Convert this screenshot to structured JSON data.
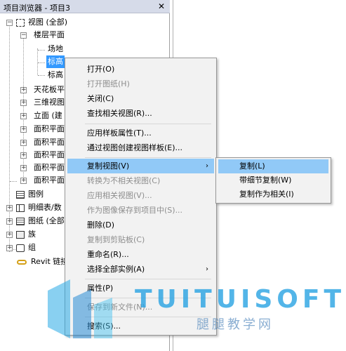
{
  "panel": {
    "title": "项目浏览器 - 项目3",
    "close_glyph": "✕"
  },
  "tree": {
    "views_root": "视图 (全部)",
    "floor_plans": "楼层平面",
    "site": "场地",
    "level_1": "标高",
    "level_2": "标高",
    "ceiling_plans": "天花板平",
    "3d_views": "三维视图",
    "elevations": "立面 (建",
    "area_plans_1": "面积平面",
    "area_plans_2": "面积平面",
    "area_plans_3": "面积平面",
    "area_plans_4": "面积平面",
    "area_plans_5": "面积平面",
    "legends": "图例",
    "schedules": "明细表/数",
    "sheets": "图纸 (全部",
    "families": "族",
    "groups": "组",
    "revit_links": "Revit 链接"
  },
  "context_menu": {
    "items": [
      {
        "label": "打开(O)",
        "enabled": true
      },
      {
        "label": "打开图纸(H)",
        "enabled": false
      },
      {
        "label": "关闭(C)",
        "enabled": true
      },
      {
        "label": "查找相关视图(R)...",
        "enabled": true
      },
      {
        "label": "应用样板属性(T)...",
        "enabled": true
      },
      {
        "label": "通过视图创建视图样板(E)...",
        "enabled": true
      },
      {
        "label": "复制视图(V)",
        "enabled": true,
        "submenu": true,
        "arrow": "›"
      },
      {
        "label": "转换为不相关视图(C)",
        "enabled": false
      },
      {
        "label": "应用相关视图(V)...",
        "enabled": false
      },
      {
        "label": "作为图像保存到项目中(S)...",
        "enabled": false
      },
      {
        "label": "删除(D)",
        "enabled": true
      },
      {
        "label": "复制到剪贴板(C)",
        "enabled": false
      },
      {
        "label": "重命名(R)...",
        "enabled": true
      },
      {
        "label": "选择全部实例(A)",
        "enabled": true,
        "submenu": true,
        "arrow": "›"
      },
      {
        "label": "属性(P)",
        "enabled": true
      },
      {
        "label": "保存到新文件(N)...",
        "enabled": false
      },
      {
        "label": "搜索(S)...",
        "enabled": true
      }
    ]
  },
  "submenu": {
    "items": [
      {
        "label": "复制(L)"
      },
      {
        "label": "带细节复制(W)"
      },
      {
        "label": "复制作为相关(I)"
      }
    ]
  },
  "watermark": {
    "text": "TUITUISOFT",
    "subtext": "腿腿教学网"
  },
  "colors": {
    "highlight": "#91c9f7",
    "selection": "#3399ff",
    "watermark": "#23a0e1"
  }
}
